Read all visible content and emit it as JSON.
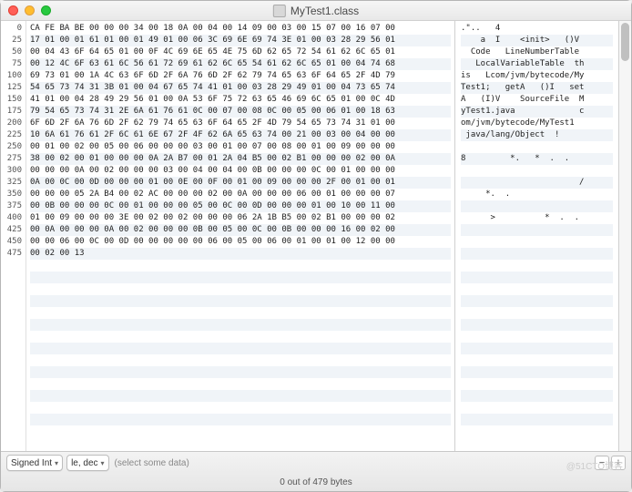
{
  "window": {
    "title": "MyTest1.class"
  },
  "offsets": [
    0,
    25,
    50,
    75,
    100,
    125,
    150,
    175,
    200,
    225,
    250,
    275,
    300,
    325,
    350,
    375,
    400,
    425,
    450,
    475
  ],
  "hex_rows": [
    "CA FE BA BE 00 00 00 34 00 18 0A 00 04 00 14 09 00 03 00 15 07 00 16 07 00",
    "17 01 00 01 61 01 00 01 49 01 00 06 3C 69 6E 69 74 3E 01 00 03 28 29 56 01",
    "00 04 43 6F 64 65 01 00 0F 4C 69 6E 65 4E 75 6D 62 65 72 54 61 62 6C 65 01",
    "00 12 4C 6F 63 61 6C 56 61 72 69 61 62 6C 65 54 61 62 6C 65 01 00 04 74 68",
    "69 73 01 00 1A 4C 63 6F 6D 2F 6A 76 6D 2F 62 79 74 65 63 6F 64 65 2F 4D 79",
    "54 65 73 74 31 3B 01 00 04 67 65 74 41 01 00 03 28 29 49 01 00 04 73 65 74",
    "41 01 00 04 28 49 29 56 01 00 0A 53 6F 75 72 63 65 46 69 6C 65 01 00 0C 4D",
    "79 54 65 73 74 31 2E 6A 61 76 61 0C 00 07 00 08 0C 00 05 00 06 01 00 18 63",
    "6F 6D 2F 6A 76 6D 2F 62 79 74 65 63 6F 64 65 2F 4D 79 54 65 73 74 31 01 00",
    "10 6A 61 76 61 2F 6C 61 6E 67 2F 4F 62 6A 65 63 74 00 21 00 03 00 04 00 00",
    "00 01 00 02 00 05 00 06 00 00 00 03 00 01 00 07 00 08 00 01 00 09 00 00 00",
    "38 00 02 00 01 00 00 00 0A 2A B7 00 01 2A 04 B5 00 02 B1 00 00 00 02 00 0A",
    "00 00 00 0A 00 02 00 00 00 03 00 04 00 04 00 0B 00 00 00 0C 00 01 00 00 00",
    "0A 00 0C 00 0D 00 00 00 01 00 0E 00 0F 00 01 00 09 00 00 00 2F 00 01 00 01",
    "00 00 00 05 2A B4 00 02 AC 00 00 00 02 00 0A 00 00 00 06 00 01 00 00 00 07",
    "00 0B 00 00 00 0C 00 01 00 00 00 05 00 0C 00 0D 00 00 00 01 00 10 00 11 00",
    "01 00 09 00 00 00 3E 00 02 00 02 00 00 00 06 2A 1B B5 00 02 B1 00 00 00 02",
    "00 0A 00 00 00 0A 00 02 00 00 00 0B 00 05 00 0C 00 0B 00 00 00 16 00 02 00",
    "00 00 06 00 0C 00 0D 00 00 00 00 00 06 00 05 00 06 00 01 00 01 00 12 00 00",
    "00 02 00 13"
  ],
  "ascii_rows": [
    ".\"..   4",
    "    a  I    <init>   ()V",
    "  Code   LineNumberTable",
    "   LocalVariableTable  th",
    "is   Lcom/jvm/bytecode/My",
    "Test1;   getA   ()I   set",
    "A   (I)V    SourceFile  M",
    "yTest1.java             c",
    "om/jvm/bytecode/MyTest1  ",
    " java/lang/Object  !",
    "",
    "8         *.   *  .  .",
    "",
    "                        /",
    "     *.  .",
    "",
    "      >          *  .  .",
    "",
    "",
    ""
  ],
  "footer": {
    "format": "Signed Int",
    "endian": "le, dec",
    "hint": "(select some data)",
    "status": "0 out of 479 bytes"
  },
  "watermark": "@51CTO博客"
}
